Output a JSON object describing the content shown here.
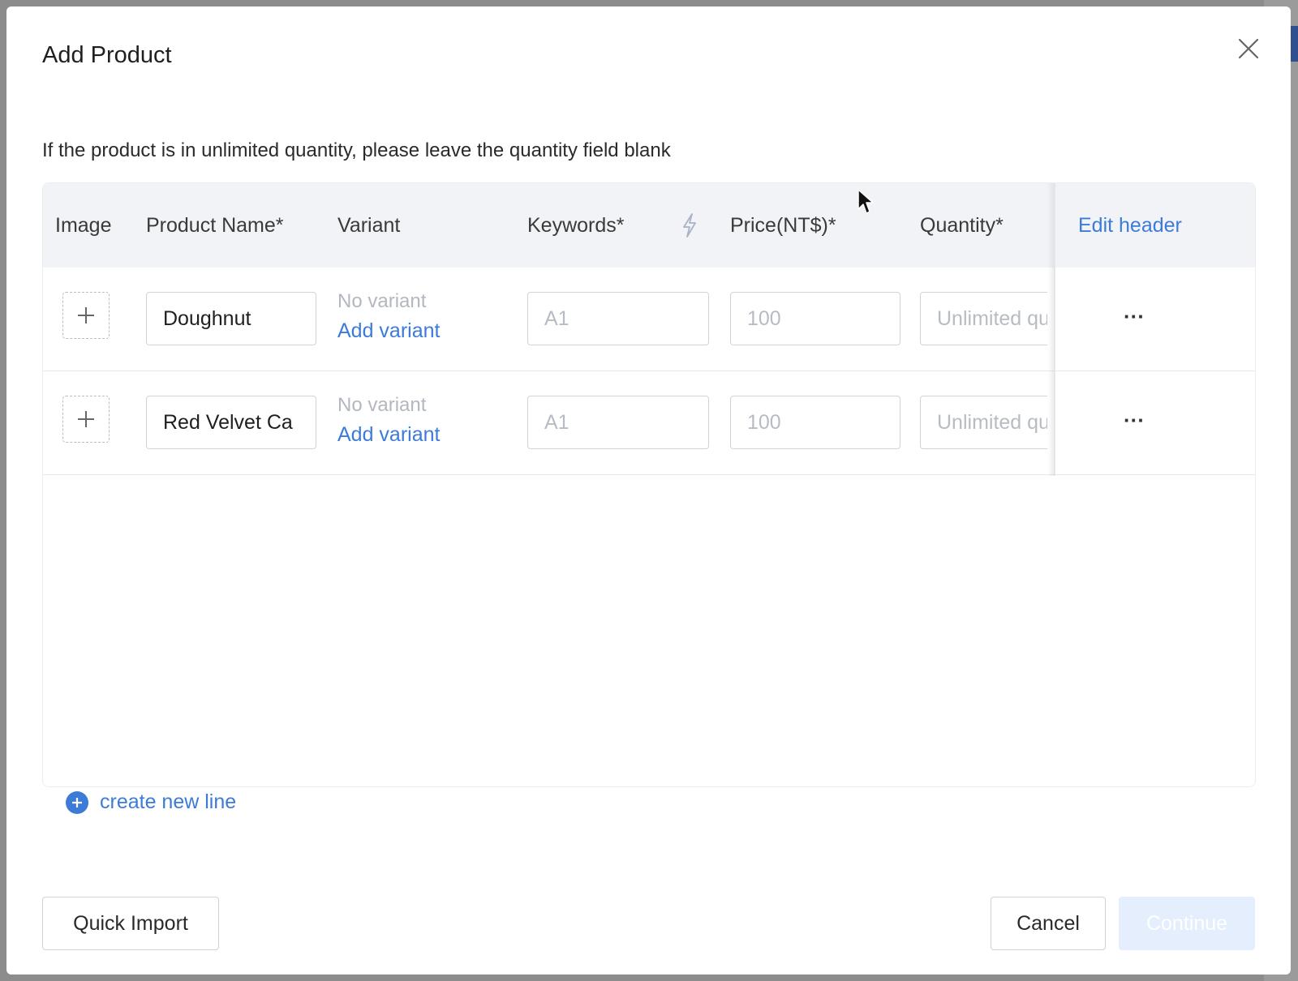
{
  "modal": {
    "title": "Add Product",
    "notice": "If the product is in unlimited quantity, please leave the quantity field blank"
  },
  "table": {
    "headers": {
      "image": "Image",
      "product_name": "Product Name*",
      "variant": "Variant",
      "keywords": "Keywords*",
      "price": "Price(NT$)*",
      "quantity": "Quantity*",
      "edit_header": "Edit header"
    },
    "rows": [
      {
        "product_name": "Doughnut",
        "variant_status": "No variant",
        "add_variant": "Add variant",
        "keywords_placeholder": "A1",
        "price_placeholder": "100",
        "quantity_placeholder": "Unlimited quantity",
        "more": "···"
      },
      {
        "product_name": "Red Velvet Ca",
        "variant_status": "No variant",
        "add_variant": "Add variant",
        "keywords_placeholder": "A1",
        "price_placeholder": "100",
        "quantity_placeholder": "Unlimited quantity",
        "more": "···"
      }
    ]
  },
  "create_line": "create new line",
  "footer": {
    "quick_import": "Quick Import",
    "cancel": "Cancel",
    "continue": "Continue"
  },
  "icons": {
    "close": "close-icon",
    "upload": "plus-icon",
    "keyword_magic": "lightning-icon",
    "add_line": "plus-circle-icon",
    "more": "more-dots-icon"
  },
  "colors": {
    "accent": "#3d7bd8",
    "header_bg": "#f1f3f7",
    "disabled_primary": "#e4eefc"
  }
}
